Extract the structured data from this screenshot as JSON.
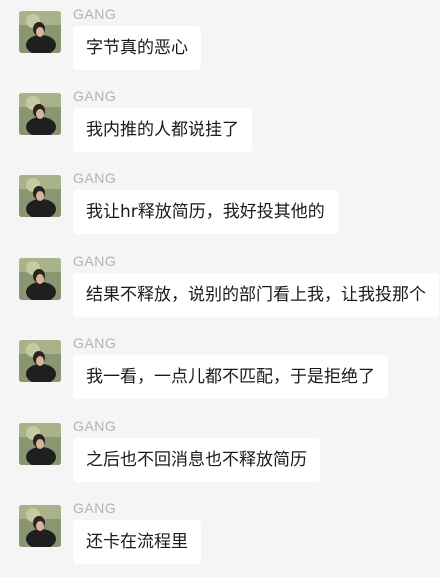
{
  "chat": {
    "messages": [
      {
        "sender": "GANG",
        "text": "字节真的恶心"
      },
      {
        "sender": "GANG",
        "text": "我内推的人都说挂了"
      },
      {
        "sender": "GANG",
        "text": "我让hr释放简历，我好投其他的"
      },
      {
        "sender": "GANG",
        "text": "结果不释放，说别的部门看上我，让我投那个"
      },
      {
        "sender": "GANG",
        "text": "我一看，一点儿都不匹配，于是拒绝了"
      },
      {
        "sender": "GANG",
        "text": "之后也不回消息也不释放简历"
      },
      {
        "sender": "GANG",
        "text": "还卡在流程里"
      }
    ]
  },
  "colors": {
    "background": "#f5f5f5",
    "bubble": "#ffffff",
    "sender_name": "#b3b3b3",
    "message_text": "#1a1a1a"
  }
}
